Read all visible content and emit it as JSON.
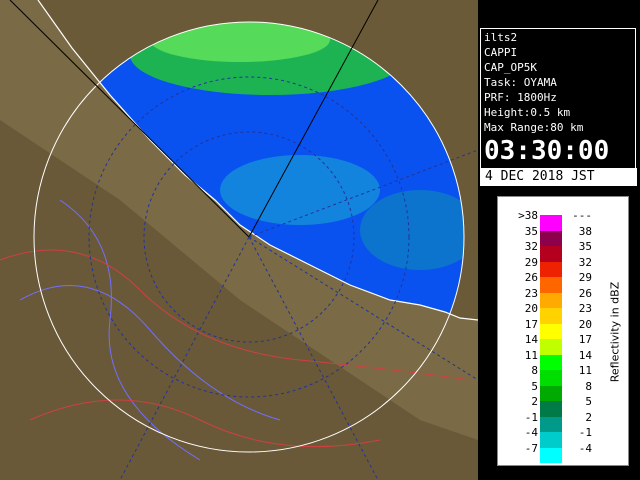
{
  "info": {
    "lines": [
      "ilts2",
      "CAPPI",
      "CAP_OP5K",
      "Task: OYAMA",
      "PRF: 1800Hz",
      "Height:0.5 km",
      "Max Range:80 km"
    ],
    "time": "03:30:00",
    "date": "4 DEC 2018 JST"
  },
  "legend": {
    "unit": "Reflectivity in dBZ",
    "rows": [
      {
        "low": ">38",
        "high": "---",
        "color": "#ff00ff"
      },
      {
        "low": "35",
        "high": "38",
        "color": "#8c004c"
      },
      {
        "low": "32",
        "high": "35",
        "color": "#b4001e"
      },
      {
        "low": "29",
        "high": "32",
        "color": "#ee2200"
      },
      {
        "low": "26",
        "high": "29",
        "color": "#ff6600"
      },
      {
        "low": "23",
        "high": "26",
        "color": "#ffaa00"
      },
      {
        "low": "20",
        "high": "23",
        "color": "#ffd200"
      },
      {
        "low": "17",
        "high": "20",
        "color": "#ffff00"
      },
      {
        "low": "14",
        "high": "17",
        "color": "#bfff00"
      },
      {
        "low": "11",
        "high": "14",
        "color": "#00ff00"
      },
      {
        "low": "8",
        "high": "11",
        "color": "#00dd00"
      },
      {
        "low": "5",
        "high": "8",
        "color": "#00aa00"
      },
      {
        "low": "2",
        "high": "5",
        "color": "#007a46"
      },
      {
        "low": "-1",
        "high": "2",
        "color": "#009a8a"
      },
      {
        "low": "-4",
        "high": "-1",
        "color": "#00cccc"
      },
      {
        "low": "-7",
        "high": "-4",
        "color": "#00ffff"
      }
    ]
  },
  "map": {
    "sea_color": "#0a52f0",
    "land_color": "#7a6a45",
    "outside_color": "#ffffff"
  }
}
